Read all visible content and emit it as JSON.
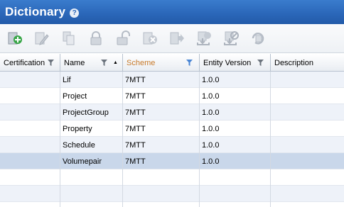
{
  "window": {
    "title": "Dictionary",
    "help_glyph": "?"
  },
  "toolbar": {
    "buttons": [
      {
        "name": "add-icon"
      },
      {
        "name": "edit-icon"
      },
      {
        "name": "copy-icon"
      },
      {
        "name": "lock-icon"
      },
      {
        "name": "unlock-icon"
      },
      {
        "name": "delete-icon"
      },
      {
        "name": "export-icon"
      },
      {
        "name": "approve-download-icon"
      },
      {
        "name": "block-download-icon"
      },
      {
        "name": "revision-icon"
      }
    ]
  },
  "grid": {
    "columns": [
      {
        "label": "Certification",
        "filter": true
      },
      {
        "label": "Name",
        "filter": true,
        "sort": "asc"
      },
      {
        "label": "Scheme",
        "filter": true,
        "filter_active": true
      },
      {
        "label": "Entity Version",
        "filter": true
      },
      {
        "label": "Description",
        "filter": false
      }
    ],
    "rows": [
      {
        "certification": "",
        "name": "Lif",
        "scheme": "7MTT",
        "version": "1.0.0",
        "description": ""
      },
      {
        "certification": "",
        "name": "Project",
        "scheme": "7MTT",
        "version": "1.0.0",
        "description": ""
      },
      {
        "certification": "",
        "name": "ProjectGroup",
        "scheme": "7MTT",
        "version": "1.0.0",
        "description": ""
      },
      {
        "certification": "",
        "name": "Property",
        "scheme": "7MTT",
        "version": "1.0.0",
        "description": ""
      },
      {
        "certification": "",
        "name": "Schedule",
        "scheme": "7MTT",
        "version": "1.0.0",
        "description": ""
      },
      {
        "certification": "",
        "name": "Volumepair",
        "scheme": "7MTT",
        "version": "1.0.0",
        "description": "",
        "selected": true
      }
    ]
  },
  "colors": {
    "titlebar": "#2a66b8",
    "selected_row": "#c9d7ea",
    "alt_row": "#eef2f9",
    "active_filter": "#4a86d4",
    "sort_label": "#c87a2a"
  }
}
